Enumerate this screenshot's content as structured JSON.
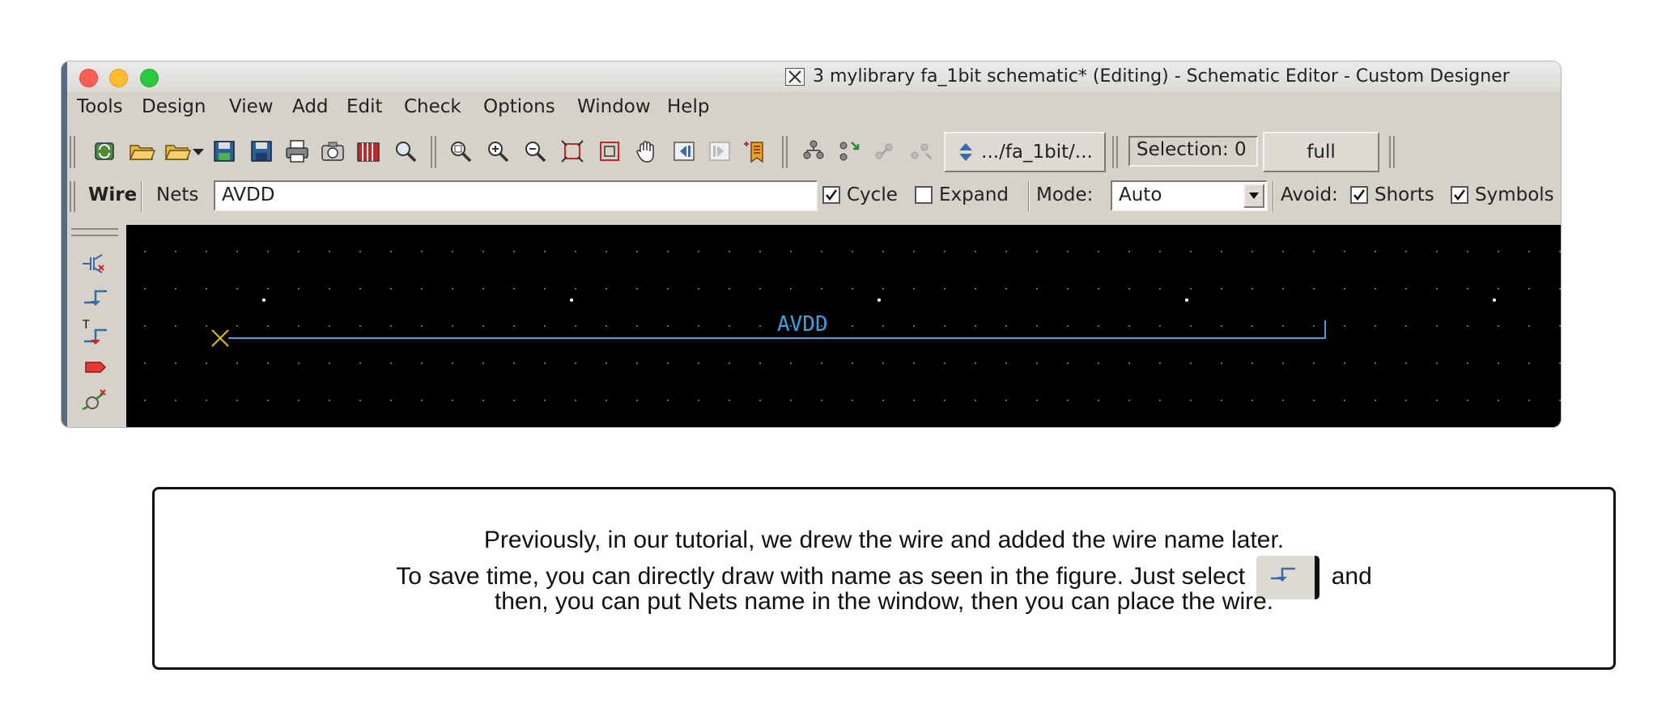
{
  "window": {
    "title": "3 mylibrary fa_1bit schematic* (Editing) - Schematic Editor - Custom Designer"
  },
  "menu": [
    "Tools",
    "Design",
    "View",
    "Add",
    "Edit",
    "Check",
    "Options",
    "Window",
    "Help"
  ],
  "toolbar": {
    "icons": [
      "refresh-icon",
      "open-folder-icon",
      "open-folder-dropdown-icon",
      "save-icon",
      "save-as-icon",
      "print-icon",
      "snapshot-icon",
      "library-icon",
      "search-icon",
      "zoom-select-icon",
      "zoom-in-icon",
      "zoom-out-icon",
      "fit-icon",
      "fit-selection-icon",
      "pan-hand-icon",
      "previous-view-icon",
      "next-view-icon",
      "bookmark-icon",
      "hierarchy-icon",
      "descend-icon",
      "ascend-icon",
      "return-icon"
    ],
    "path_button": ".../fa_1bit/...",
    "selection_label": "Selection: 0",
    "full_button": "full"
  },
  "wirebar": {
    "mode_label": "Wire",
    "nets_label": "Nets",
    "nets_value": "AVDD",
    "cycle_label": "Cycle",
    "cycle_checked": true,
    "expand_label": "Expand",
    "expand_checked": false,
    "mode_prefix": "Mode:",
    "mode_value": "Auto",
    "avoid_label": "Avoid:",
    "shorts_label": "Shorts",
    "shorts_checked": true,
    "symbols_label": "Symbols",
    "symbols_checked": true
  },
  "palette": [
    "add-instance-icon",
    "add-wire-icon",
    "add-wire-name-icon",
    "add-pin-icon",
    "add-component-icon"
  ],
  "canvas": {
    "wire_name": "AVDD",
    "wire_color": "#3aa3e0",
    "start_marker_color": "#d8c600"
  },
  "note": {
    "line1": "Previously, in our tutorial, we drew the wire and added the wire name later.",
    "line2_before": "To save time, you can directly draw with name as seen in the figure. Just select",
    "line2_after": "and",
    "line3": "then, you can put Nets name in the window, then you can place the wire."
  }
}
